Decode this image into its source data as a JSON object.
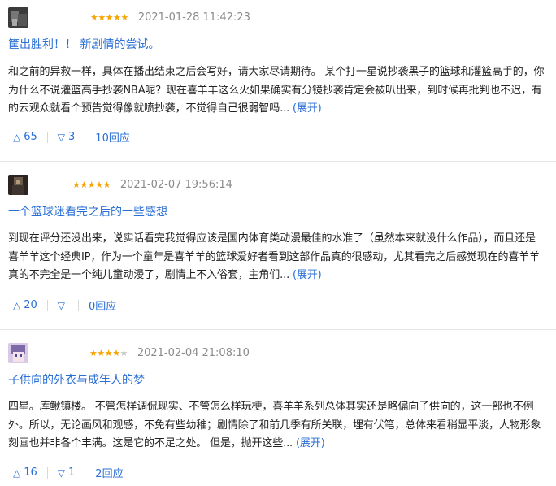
{
  "reviews": [
    {
      "avatar": "avatar-1",
      "stars": "★★★★★",
      "stars_off": "",
      "time": "2021-01-28 11:42:23",
      "title": "筐出胜利！！ 新剧情的尝试。",
      "body_lines": [
        "和之前的异救一样，具体在播出结束之后会写好，请大家尽请期待。 某个打一星说抄袭黑子的篮球和灌篮高手的，你",
        "为什么不说灌篮高手抄袭NBA呢？现在喜羊羊这么火如果确实有分镜抄袭肯定会被叭出来，到时候再批判也不迟，有",
        "的云观众就看个预告觉得像就喷抄袭，不觉得自己很弱智吗..."
      ],
      "expand": "(展开)",
      "up": "65",
      "down": "3",
      "replies": "10回应"
    },
    {
      "avatar": "avatar-2",
      "stars": "★★★★★",
      "stars_off": "",
      "time": "2021-02-07 19:56:14",
      "title": "一个篮球迷看完之后的一些感想",
      "body_lines": [
        "到现在评分还没出来，说实话看完我觉得应该是国内体育类动漫最佳的水准了（虽然本来就没什么作品），而且还是",
        "喜羊羊这个经典IP，作为一个童年是喜羊羊的篮球爱好者看到这部作品真的很感动，尤其看完之后感觉现在的喜羊羊",
        "真的不完全是一个纯儿童动漫了，剧情上不入俗套，主角们..."
      ],
      "expand": "(展开)",
      "up": "20",
      "down": "",
      "replies": "0回应"
    },
    {
      "avatar": "avatar-3",
      "stars": "★★★★",
      "stars_off": "★",
      "time": "2021-02-04 21:08:10",
      "title": "子供向的外衣与成年人的梦",
      "body_lines": [
        "四星。库鳅镇楼。 不管怎样调侃现实、不管怎么样玩梗，喜羊羊系列总体其实还是略偏向子供向的，这一部也不例",
        "外。所以，无论画风和观感，不免有些幼稚；剧情除了和前几季有所关联，埋有伏笔，总体来看稍显平淡，人物形象",
        "刻画也并非各个丰满。这是它的不足之处。 但是，抛开这些..."
      ],
      "expand": "(展开)",
      "up": "16",
      "down": "1",
      "replies": "2回应"
    }
  ]
}
